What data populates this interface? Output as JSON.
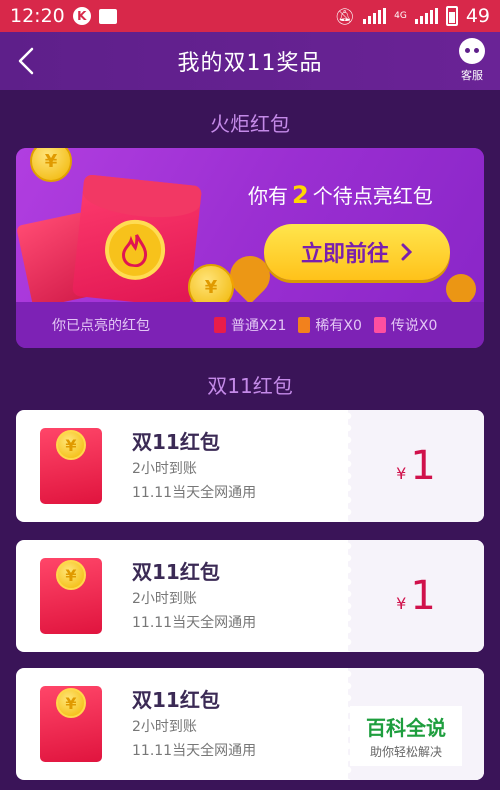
{
  "status_bar": {
    "time": "12:20",
    "battery": "49",
    "network": "4G"
  },
  "header": {
    "title": "我的双11奖品",
    "service_label": "客服"
  },
  "torch_section": {
    "title": "火炬红包",
    "prompt_prefix": "你有",
    "pending_count": "2",
    "prompt_suffix": "个待点亮红包",
    "go_button": "立即前往",
    "lit_label": "你已点亮的红包",
    "tiers": [
      {
        "label": "普通X21",
        "color": "#e81d4a"
      },
      {
        "label": "稀有X0",
        "color": "#f2811d"
      },
      {
        "label": "传说X0",
        "color": "#ff4fa0"
      }
    ]
  },
  "rewards_section": {
    "title": "双11红包",
    "items": [
      {
        "name": "双11红包",
        "time": "2小时到账",
        "scope": "11.11当天全网通用",
        "currency": "¥",
        "amount": "1"
      },
      {
        "name": "双11红包",
        "time": "2小时到账",
        "scope": "11.11当天全网通用",
        "currency": "¥",
        "amount": "1"
      },
      {
        "name": "双11红包",
        "time": "2小时到账",
        "scope": "11.11当天全网通用",
        "currency": "",
        "amount": ""
      }
    ]
  },
  "watermark": {
    "brand": "百科全说",
    "slogan": "助你轻松解决"
  },
  "colors": {
    "status_bar": "#d8284a",
    "background": "#3a1458",
    "accent_purple": "#8a2bbf",
    "button_yellow": "#ffc21a",
    "amount_red": "#d0114b"
  }
}
